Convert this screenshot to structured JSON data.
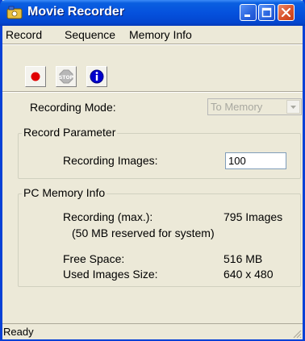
{
  "window": {
    "title": "Movie Recorder"
  },
  "menu": [
    "Record",
    "Sequence",
    "Memory Info"
  ],
  "toolbar": {
    "record_icon": "record-icon",
    "stop_icon": "stop-icon",
    "info_icon": "info-icon"
  },
  "recording_mode": {
    "label": "Recording Mode:",
    "value": "To Memory"
  },
  "record_parameter": {
    "title": "Record Parameter",
    "images_label": "Recording Images:",
    "images_value": "100"
  },
  "memory_info": {
    "title": "PC Memory Info",
    "recording_max_label": "Recording (max.):",
    "recording_max_value": "795 Images",
    "reserved_note": "(50 MB reserved for system)",
    "free_space_label": "Free Space:",
    "free_space_value": "516 MB",
    "image_size_label": "Used Images Size:",
    "image_size_value": "640 x 480"
  },
  "status": {
    "text": "Ready"
  },
  "colors": {
    "titlebar": "#0551dd",
    "record": "#e00000",
    "info": "#0000cc"
  }
}
